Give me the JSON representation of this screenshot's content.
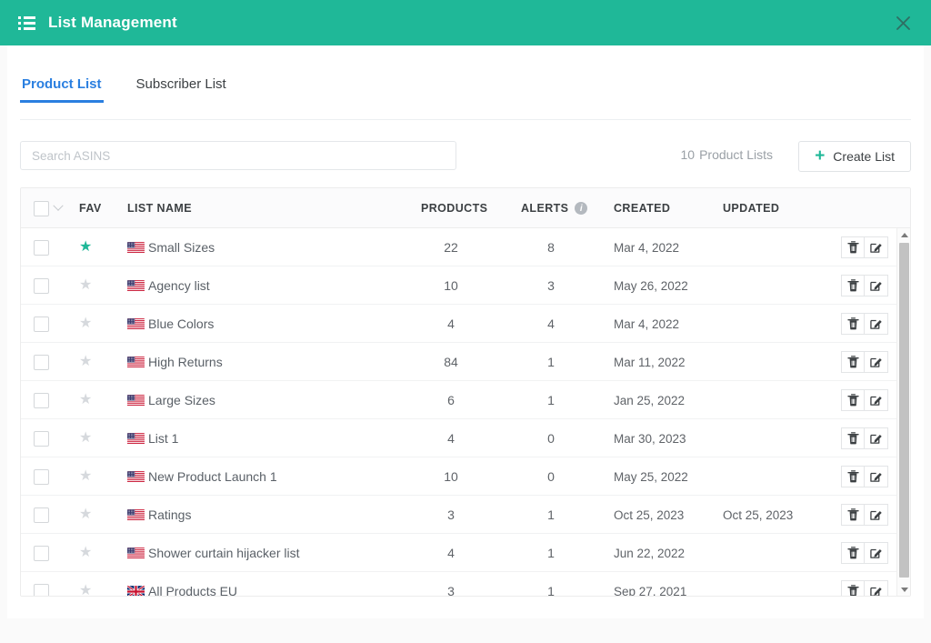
{
  "header": {
    "title": "List Management",
    "icon": "list-icon",
    "close_icon": "close-icon",
    "bg_color": "#1fb898"
  },
  "tabs": [
    {
      "label": "Product List",
      "active": true
    },
    {
      "label": "Subscriber List",
      "active": false
    }
  ],
  "toolbar": {
    "search_placeholder": "Search ASINS",
    "search_value": "",
    "count": "10",
    "count_label": "Product Lists",
    "create_label": "Create List",
    "create_icon": "plus-icon",
    "accent_color": "#1fb898"
  },
  "table": {
    "columns": {
      "fav": "FAV",
      "name": "LIST NAME",
      "products": "PRODUCTS",
      "alerts": "ALERTS",
      "created": "CREATED",
      "updated": "UPDATED"
    },
    "alerts_info_icon": "info-icon",
    "rows": [
      {
        "fav": true,
        "flag": "us",
        "name": "Small Sizes",
        "products": "22",
        "alerts": "8",
        "created": "Mar 4, 2022",
        "updated": ""
      },
      {
        "fav": false,
        "flag": "us",
        "name": "Agency list",
        "products": "10",
        "alerts": "3",
        "created": "May 26, 2022",
        "updated": ""
      },
      {
        "fav": false,
        "flag": "us",
        "name": "Blue Colors",
        "products": "4",
        "alerts": "4",
        "created": "Mar 4, 2022",
        "updated": ""
      },
      {
        "fav": false,
        "flag": "us",
        "name": "High Returns",
        "products": "84",
        "alerts": "1",
        "created": "Mar 11, 2022",
        "updated": ""
      },
      {
        "fav": false,
        "flag": "us",
        "name": "Large Sizes",
        "products": "6",
        "alerts": "1",
        "created": "Jan 25, 2022",
        "updated": ""
      },
      {
        "fav": false,
        "flag": "us",
        "name": "List 1",
        "products": "4",
        "alerts": "0",
        "created": "Mar 30, 2023",
        "updated": ""
      },
      {
        "fav": false,
        "flag": "us",
        "name": "New Product Launch 1",
        "products": "10",
        "alerts": "0",
        "created": "May 25, 2022",
        "updated": ""
      },
      {
        "fav": false,
        "flag": "us",
        "name": "Ratings",
        "products": "3",
        "alerts": "1",
        "created": "Oct 25, 2023",
        "updated": "Oct 25, 2023"
      },
      {
        "fav": false,
        "flag": "us",
        "name": "Shower curtain hijacker list",
        "products": "4",
        "alerts": "1",
        "created": "Jun 22, 2022",
        "updated": ""
      },
      {
        "fav": false,
        "flag": "uk",
        "name": "All Products EU",
        "products": "3",
        "alerts": "1",
        "created": "Sep 27, 2021",
        "updated": ""
      }
    ],
    "row_actions": {
      "delete_icon": "trash-icon",
      "edit_icon": "edit-icon"
    }
  },
  "scrollbar": {
    "up_icon": "caret-up-icon",
    "down_icon": "caret-down-icon"
  }
}
